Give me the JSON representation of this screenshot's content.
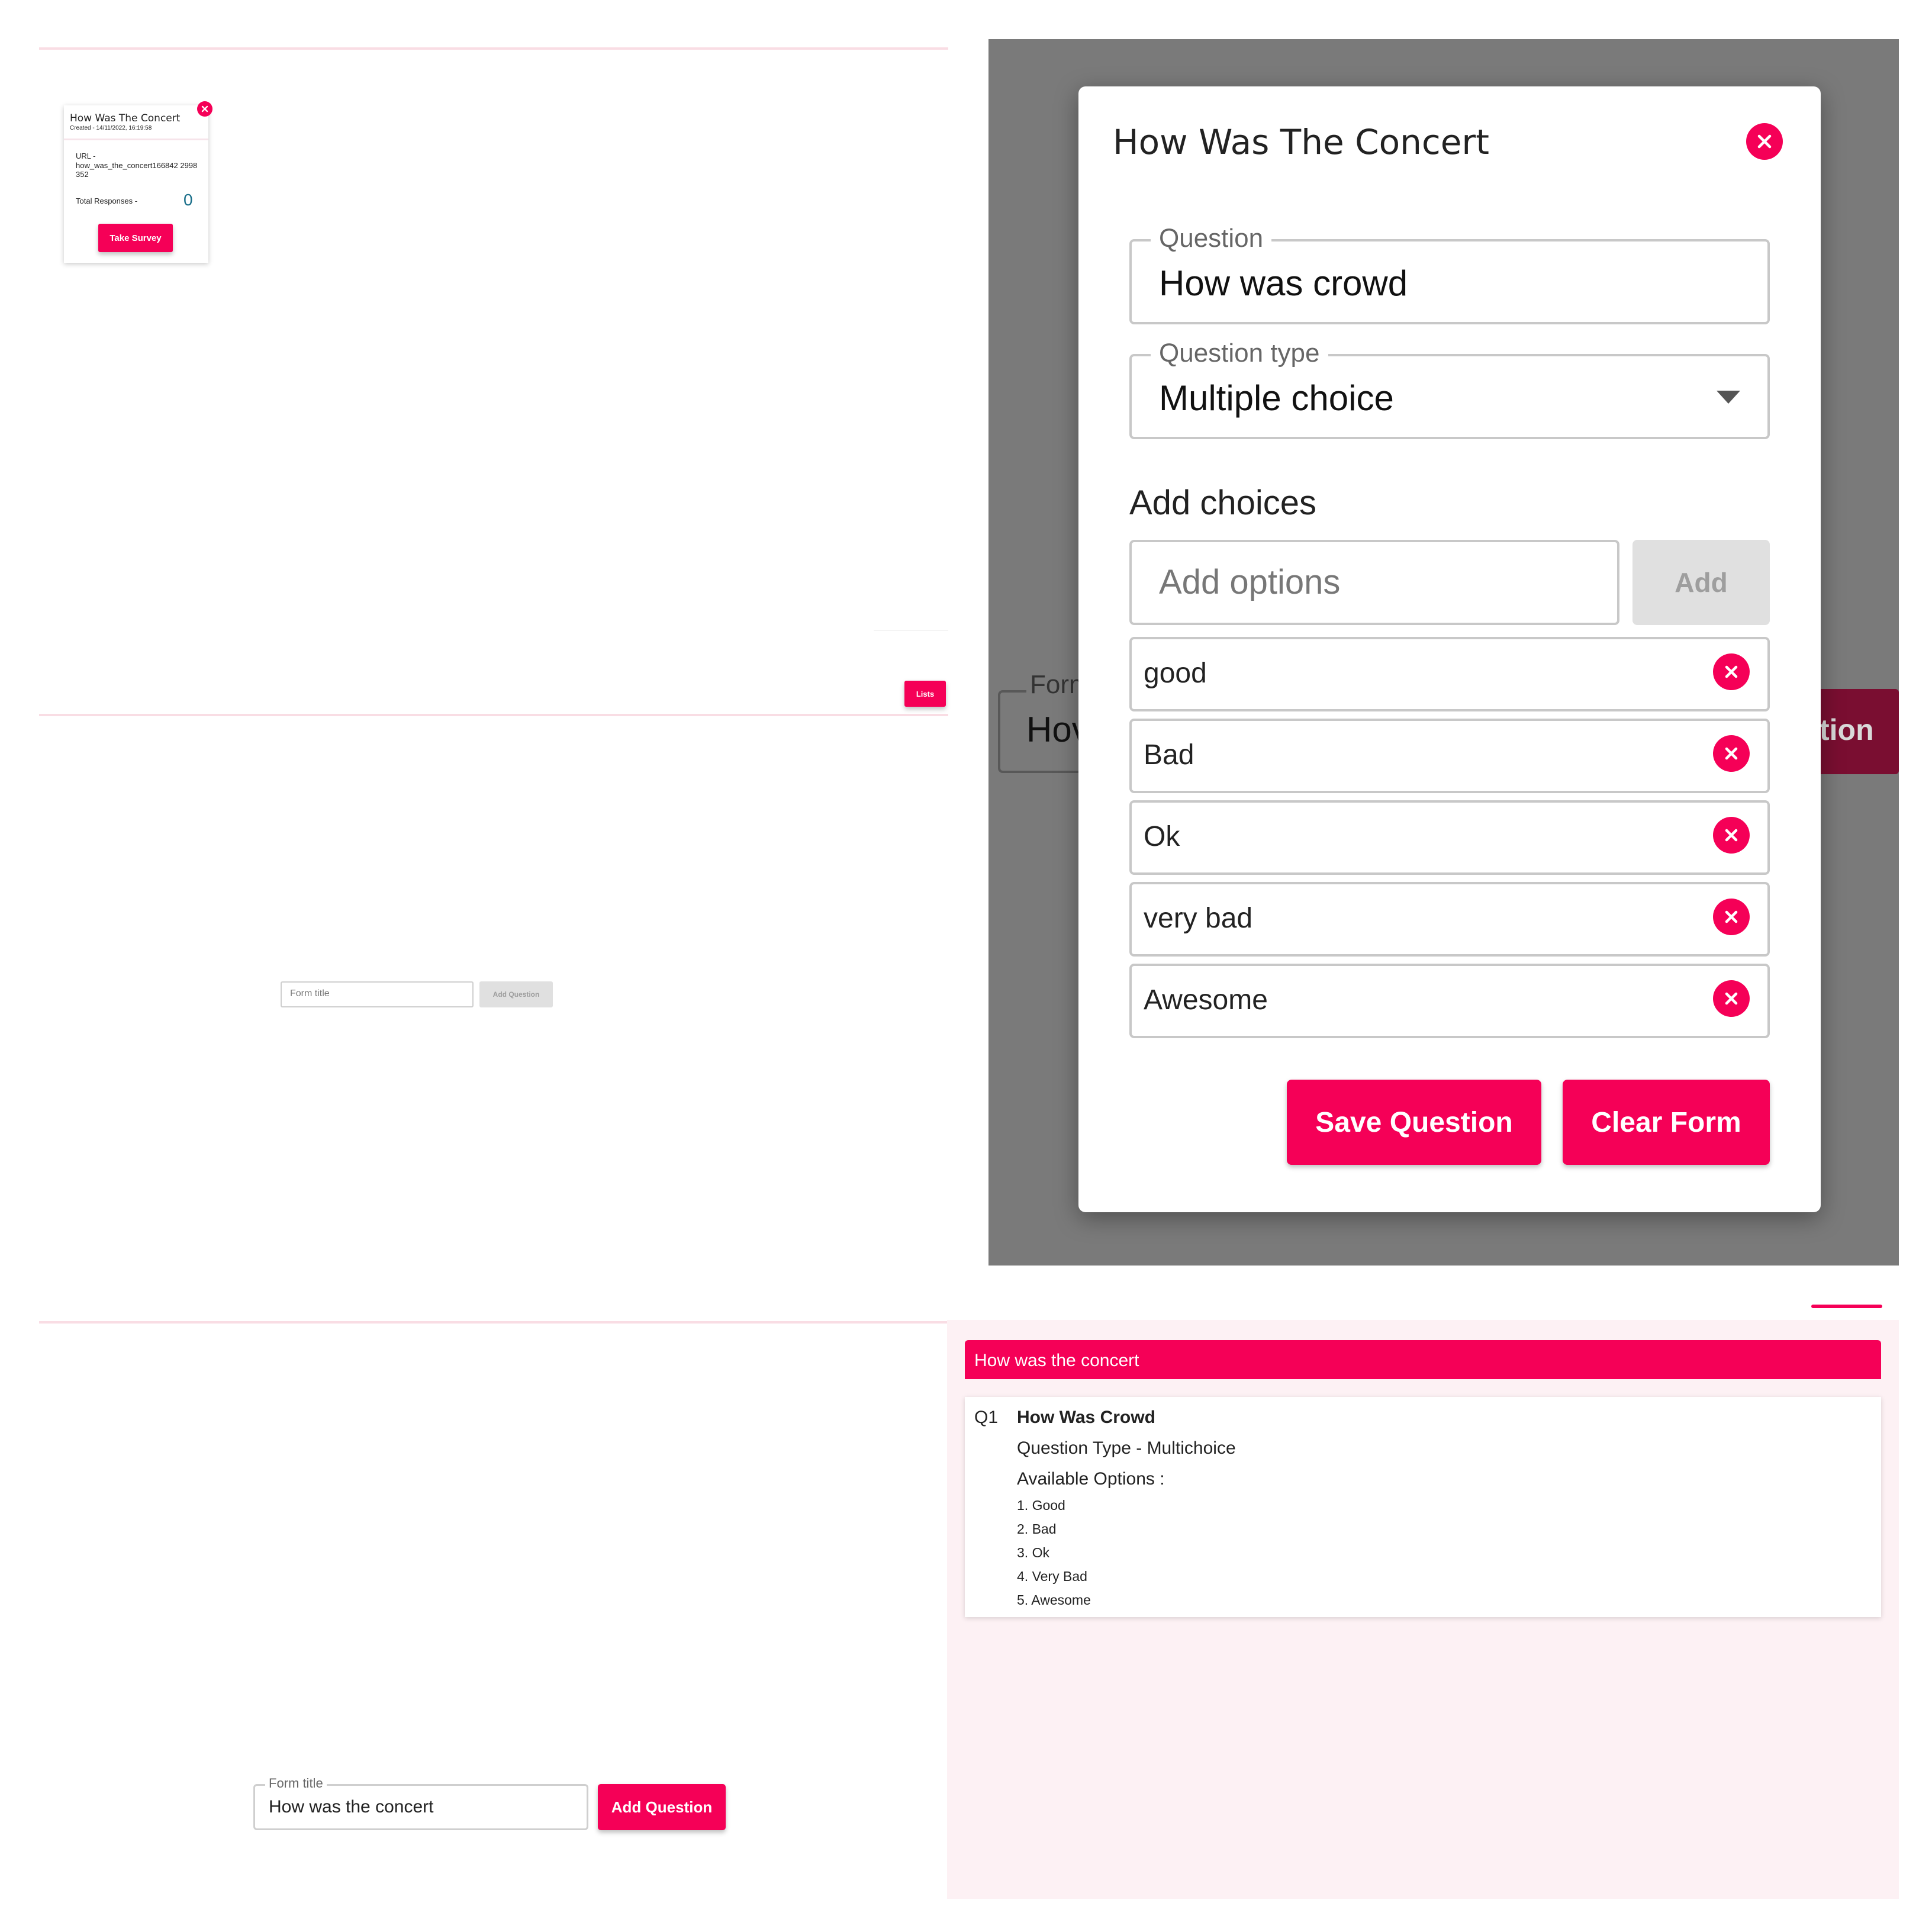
{
  "panel1": {
    "card": {
      "title": "How Was The Concert",
      "created": "Created - 14/11/2022, 16:19:58",
      "url_label": "URL -",
      "url_value": "how_was_the_concert166842 2998352",
      "responses_label": "Total Responses -",
      "responses_count": "0",
      "take_survey": "Take Survey"
    },
    "lists_button": "Lists"
  },
  "panel2": {
    "title": "How Was The Concert",
    "question_legend": "Question",
    "question_value": "How was crowd",
    "type_legend": "Question type",
    "type_value": "Multiple choice",
    "add_choices_heading": "Add choices",
    "add_options_placeholder": "Add options",
    "add_button": "Add",
    "choices": [
      "good",
      "Bad",
      "Ok",
      "very bad",
      "Awesome"
    ],
    "save_button": "Save Question",
    "clear_button": "Clear Form",
    "bg_form_legend": "Form",
    "bg_form_value": "Hov",
    "bg_button_fragment": "tion"
  },
  "panel3": {
    "form_title_placeholder": "Form title",
    "add_question": "Add Question"
  },
  "panel4": {
    "form_title_legend": "Form title",
    "form_title_value": "How was the concert",
    "add_question": "Add Question"
  },
  "panel5": {
    "header": "How was the concert",
    "q_number": "Q1",
    "q_title": "How Was Crowd",
    "q_type": "Question Type - Multichoice",
    "options_label": "Available Options :",
    "options": [
      "1. Good",
      "2. Bad",
      "3. Ok",
      "4. Very Bad",
      "5. Awesome"
    ]
  },
  "colors": {
    "accent": "#f50057",
    "overlay": "#7a7a7a",
    "pink_bg": "#fdf1f4"
  }
}
